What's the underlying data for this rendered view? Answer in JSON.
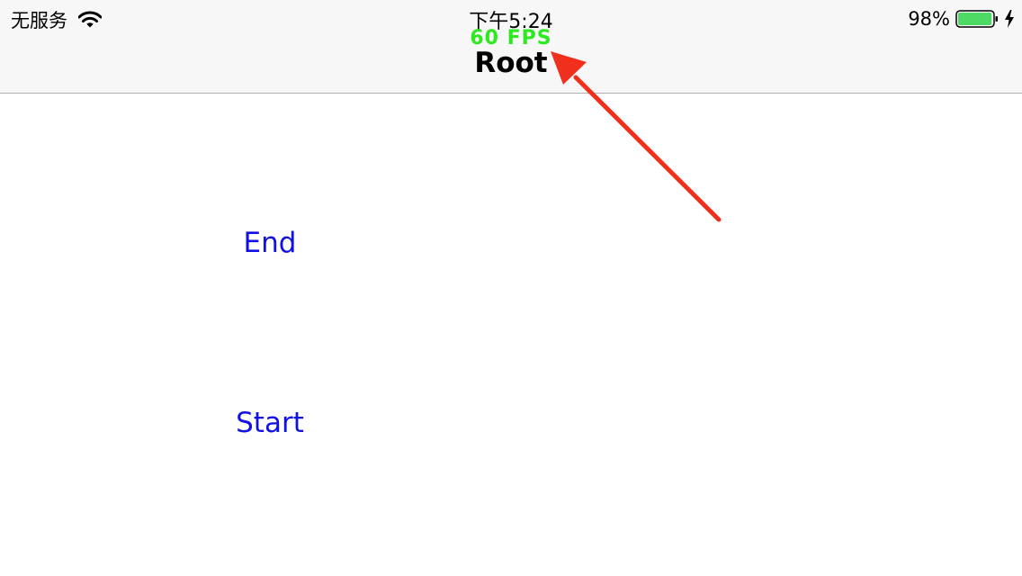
{
  "status_bar": {
    "carrier": "无服务",
    "time": "下午5:24",
    "battery_percent": "98%",
    "battery_level": 0.98,
    "battery_color": "#4cd964",
    "icons": [
      "wifi-icon",
      "battery-icon",
      "charging-bolt-icon"
    ]
  },
  "overlay": {
    "fps": "60 FPS",
    "fps_color": "#2dea1f",
    "arrow_color": "#f0301c"
  },
  "navbar": {
    "title": "Root"
  },
  "main": {
    "end_label": "End",
    "start_label": "Start",
    "button_color": "#1111e6"
  }
}
